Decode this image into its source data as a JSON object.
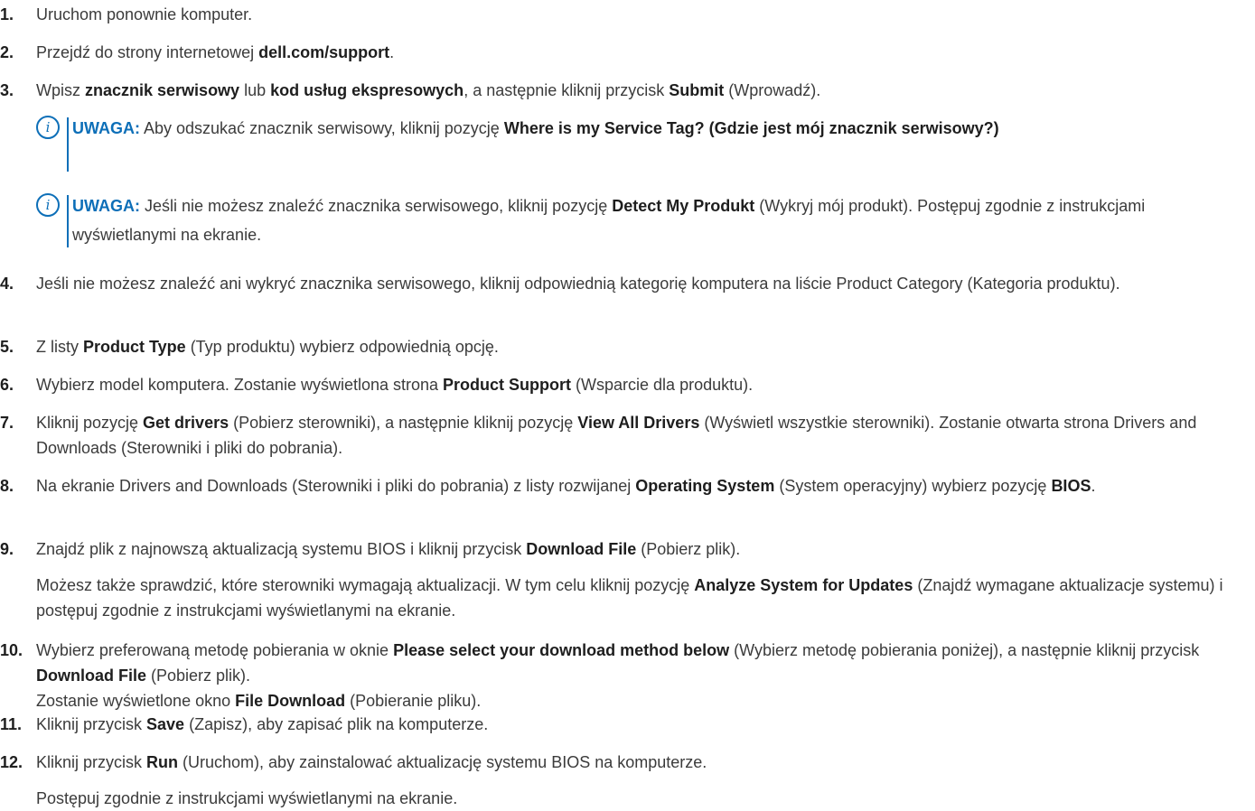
{
  "colors": {
    "accent": "#0d6fb8",
    "text": "#3b3b3b",
    "bold_text": "#1e1e1e"
  },
  "note_icon_glyph": "i",
  "steps": [
    {
      "num": "1.",
      "parts": [
        {
          "t": "Uruchom ponownie komputer."
        }
      ]
    },
    {
      "num": "2.",
      "parts": [
        {
          "t": "Przejdź do strony internetowej "
        },
        {
          "t": "dell.com/support",
          "b": true
        },
        {
          "t": "."
        }
      ]
    },
    {
      "num": "3.",
      "parts": [
        {
          "t": "Wpisz "
        },
        {
          "t": "znacznik serwisowy",
          "b": true
        },
        {
          "t": " lub "
        },
        {
          "t": "kod usług ekspresowych",
          "b": true
        },
        {
          "t": ", a następnie kliknij przycisk "
        },
        {
          "t": "Submit",
          "b": true
        },
        {
          "t": " (Wprowadź)."
        }
      ]
    },
    {
      "num": "4.",
      "parts": [
        {
          "t": "Jeśli nie możesz znaleźć ani wykryć znacznika serwisowego, kliknij odpowiednią kategorię komputera na liście Product Category (Kategoria produktu)."
        }
      ]
    },
    {
      "num": "5.",
      "parts": [
        {
          "t": "Z listy "
        },
        {
          "t": "Product Type",
          "b": true
        },
        {
          "t": " (Typ produktu) wybierz odpowiednią opcję."
        }
      ]
    },
    {
      "num": "6.",
      "parts": [
        {
          "t": "Wybierz model komputera. Zostanie wyświetlona strona "
        },
        {
          "t": "Product Support",
          "b": true
        },
        {
          "t": " (Wsparcie dla produktu)."
        }
      ]
    },
    {
      "num": "7.",
      "parts": [
        {
          "t": "Kliknij pozycję "
        },
        {
          "t": "Get drivers",
          "b": true
        },
        {
          "t": " (Pobierz sterowniki), a następnie kliknij pozycję "
        },
        {
          "t": "View All Drivers",
          "b": true
        },
        {
          "t": " (Wyświetl wszystkie sterowniki). Zostanie otwarta strona Drivers and Downloads (Sterowniki i pliki do pobrania)."
        }
      ]
    },
    {
      "num": "8.",
      "parts": [
        {
          "t": "Na ekranie Drivers and Downloads (Sterowniki i pliki do pobrania) z listy rozwijanej "
        },
        {
          "t": "Operating System",
          "b": true
        },
        {
          "t": " (System operacyjny) wybierz pozycję "
        },
        {
          "t": "BIOS",
          "b": true
        },
        {
          "t": "."
        }
      ]
    },
    {
      "num": "9.",
      "parts": [
        {
          "t": "Znajdź plik z najnowszą aktualizacją systemu BIOS i kliknij przycisk "
        },
        {
          "t": "Download File",
          "b": true
        },
        {
          "t": " (Pobierz plik)."
        }
      ]
    },
    {
      "num": "10.",
      "parts": [
        {
          "t": "Wybierz preferowaną metodę pobierania w oknie "
        },
        {
          "t": "Please select your download method below",
          "b": true
        },
        {
          "t": " (Wybierz metodę pobierania poniżej), a następnie kliknij przycisk "
        },
        {
          "t": "Download File",
          "b": true
        },
        {
          "t": " (Pobierz plik)."
        }
      ]
    },
    {
      "num": "11.",
      "parts": [
        {
          "t": "Kliknij przycisk "
        },
        {
          "t": "Save",
          "b": true
        },
        {
          "t": " (Zapisz), aby zapisać plik na komputerze."
        }
      ]
    },
    {
      "num": "12.",
      "parts": [
        {
          "t": "Kliknij przycisk "
        },
        {
          "t": "Run",
          "b": true
        },
        {
          "t": " (Uruchom), aby zainstalować aktualizację systemu BIOS na komputerze."
        }
      ]
    }
  ],
  "step9_followup": [
    {
      "t": "Możesz także sprawdzić, które sterowniki wymagają aktualizacji. W tym celu kliknij pozycję "
    },
    {
      "t": "Analyze System for Updates",
      "b": true
    },
    {
      "t": " (Znajdź wymagane aktualizacje systemu) i postępuj zgodnie z instrukcjami wyświetlanymi na ekranie."
    }
  ],
  "step10_followup": [
    {
      "t": "Zostanie wyświetlone okno "
    },
    {
      "t": "File Download",
      "b": true
    },
    {
      "t": " (Pobieranie pliku)."
    }
  ],
  "step12_followup": [
    {
      "t": "Postępuj zgodnie z instrukcjami wyświetlanymi na ekranie."
    }
  ],
  "notes": [
    {
      "label": "UWAGA:",
      "parts": [
        {
          "t": " Aby odszukać znacznik serwisowy, kliknij pozycję "
        },
        {
          "t": "Where is my Service Tag? (Gdzie jest mój znacznik serwisowy?)",
          "b": true
        }
      ]
    },
    {
      "label": "UWAGA:",
      "parts": [
        {
          "t": " Jeśli nie możesz znaleźć znacznika serwisowego, kliknij pozycję "
        },
        {
          "t": "Detect My Produkt",
          "b": true
        },
        {
          "t": " (Wykryj mój produkt). Postępuj zgodnie z instrukcjami wyświetlanymi na ekranie."
        }
      ]
    }
  ]
}
